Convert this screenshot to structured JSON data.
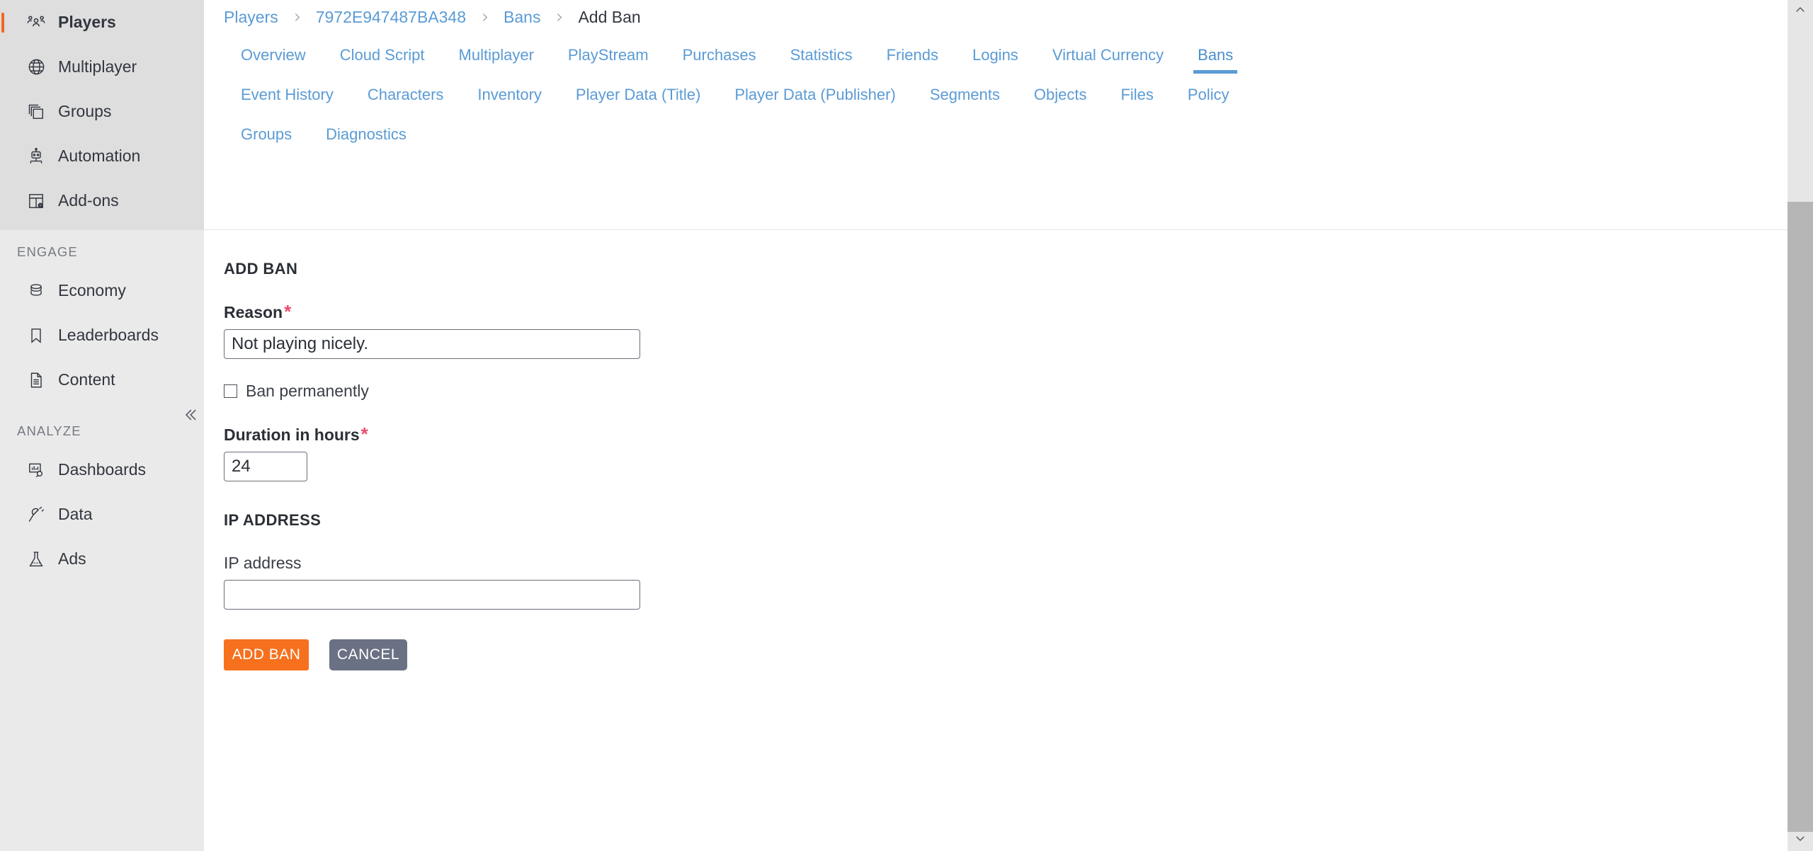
{
  "sidebar": {
    "groups": [
      {
        "title": null,
        "items": [
          {
            "label": "Players",
            "icon": "players-icon",
            "active": true
          },
          {
            "label": "Multiplayer",
            "icon": "globe-icon",
            "active": false
          },
          {
            "label": "Groups",
            "icon": "layers-icon",
            "active": false
          },
          {
            "label": "Automation",
            "icon": "robot-icon",
            "active": false
          },
          {
            "label": "Add-ons",
            "icon": "addons-icon",
            "active": false
          }
        ]
      },
      {
        "title": "ENGAGE",
        "items": [
          {
            "label": "Economy",
            "icon": "coins-icon",
            "active": false
          },
          {
            "label": "Leaderboards",
            "icon": "bookmark-icon",
            "active": false
          },
          {
            "label": "Content",
            "icon": "document-icon",
            "active": false
          }
        ]
      },
      {
        "title": "ANALYZE",
        "items": [
          {
            "label": "Dashboards",
            "icon": "dashboard-search-icon",
            "active": false
          },
          {
            "label": "Data",
            "icon": "plug-icon",
            "active": false
          },
          {
            "label": "Ads",
            "icon": "flask-icon",
            "active": false
          }
        ]
      }
    ],
    "collapse_icon": "double-chevron-left-icon",
    "accent_color": "#f16722"
  },
  "breadcrumb": {
    "items": [
      {
        "label": "Players",
        "current": false
      },
      {
        "label": "7972E947487BA348",
        "current": false
      },
      {
        "label": "Bans",
        "current": false
      },
      {
        "label": "Add Ban",
        "current": true
      }
    ],
    "separator_icon": "chevron-right-icon",
    "link_color": "#5b9bd5"
  },
  "tabs": {
    "rows": [
      [
        {
          "label": "Overview",
          "active": false
        },
        {
          "label": "Cloud Script",
          "active": false
        },
        {
          "label": "Multiplayer",
          "active": false
        },
        {
          "label": "PlayStream",
          "active": false
        },
        {
          "label": "Purchases",
          "active": false
        },
        {
          "label": "Statistics",
          "active": false
        },
        {
          "label": "Friends",
          "active": false
        },
        {
          "label": "Logins",
          "active": false
        },
        {
          "label": "Virtual Currency",
          "active": false
        },
        {
          "label": "Bans",
          "active": true
        }
      ],
      [
        {
          "label": "Event History",
          "active": false
        },
        {
          "label": "Characters",
          "active": false
        },
        {
          "label": "Inventory",
          "active": false
        },
        {
          "label": "Player Data (Title)",
          "active": false
        },
        {
          "label": "Player Data (Publisher)",
          "active": false
        },
        {
          "label": "Segments",
          "active": false
        },
        {
          "label": "Objects",
          "active": false
        },
        {
          "label": "Files",
          "active": false
        },
        {
          "label": "Policy",
          "active": false
        }
      ],
      [
        {
          "label": "Groups",
          "active": false
        },
        {
          "label": "Diagnostics",
          "active": false
        }
      ]
    ]
  },
  "form": {
    "heading": "ADD BAN",
    "reason": {
      "label": "Reason",
      "required_marker": "*",
      "value": "Not playing nicely.",
      "placeholder": ""
    },
    "ban_permanently": {
      "label": "Ban permanently",
      "checked": false
    },
    "duration": {
      "label": "Duration in hours",
      "required_marker": "*",
      "value": "24",
      "placeholder": ""
    },
    "ip_section": {
      "heading": "IP ADDRESS",
      "label": "IP address",
      "value": "",
      "placeholder": ""
    },
    "actions": {
      "submit_label": "ADD BAN",
      "cancel_label": "CANCEL",
      "submit_color": "#f7701d",
      "cancel_color": "#6b7184"
    },
    "required_color": "#ea4c6e"
  },
  "scrollbar": {
    "up_icon": "chevron-up-icon",
    "down_icon": "chevron-down-icon"
  }
}
